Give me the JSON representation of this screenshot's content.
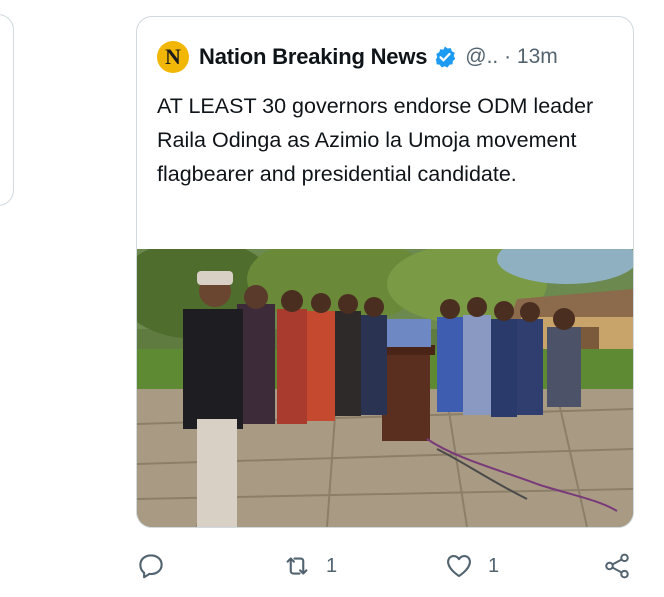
{
  "quoted_tweet": {
    "avatar_letter": "N",
    "display_name": "Nation Breaking News",
    "handle_time": "@.. · 13m",
    "text": "AT LEAST 30 governors endorse ODM leader Raila Odinga as Azimio la Umoja movement flagbearer and presidential candidate.",
    "media": "photo"
  },
  "actions": {
    "reply_icon": "speech-bubble",
    "retweet_icon": "retweet-arrows",
    "retweet_count": "1",
    "like_icon": "heart",
    "like_count": "1",
    "share_icon": "share-nodes"
  },
  "colors": {
    "border": "#cfd9de",
    "muted": "#536471",
    "verified": "#1d9bf0",
    "avatar_bg": "#f2b705"
  }
}
